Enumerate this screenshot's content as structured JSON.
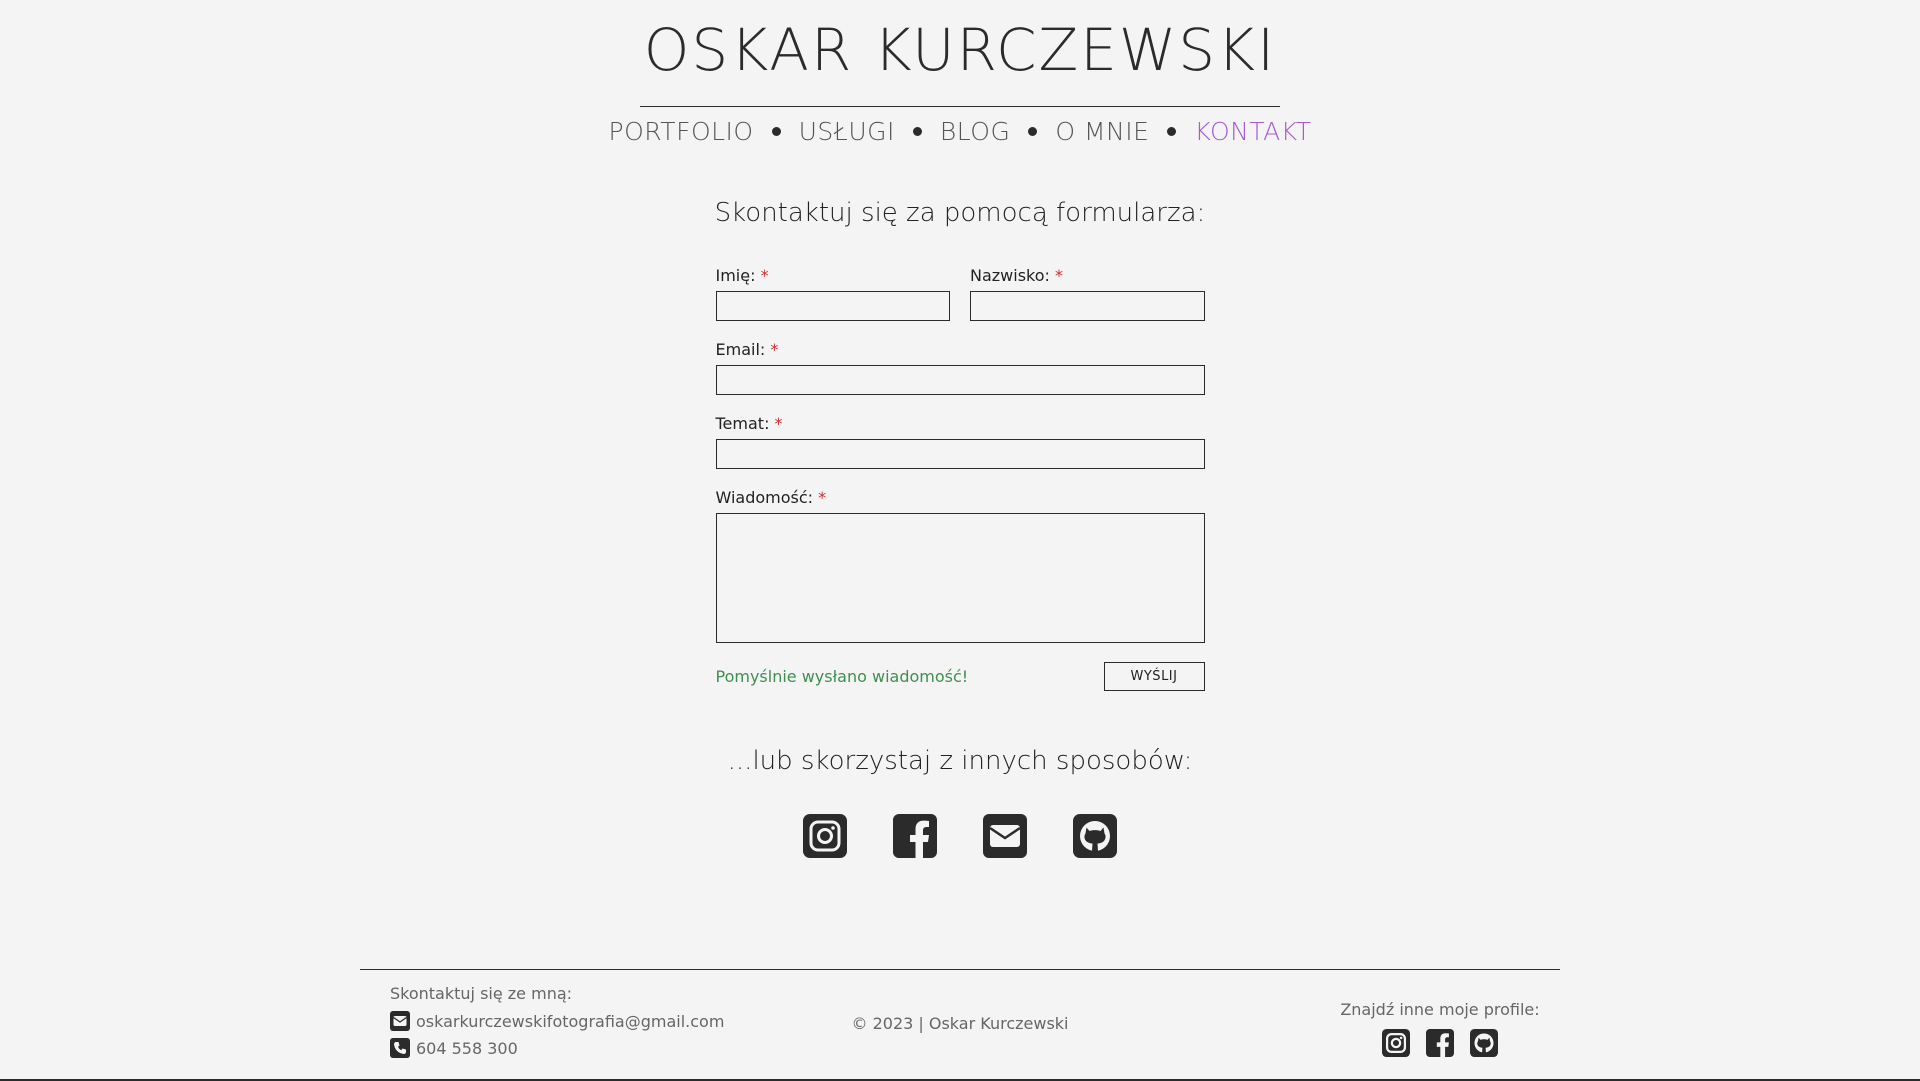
{
  "header": {
    "title": "OSKAR KURCZEWSKI"
  },
  "nav": {
    "items": [
      {
        "label": "PORTFOLIO"
      },
      {
        "label": "USŁUGI"
      },
      {
        "label": "BLOG"
      },
      {
        "label": "O MNIE"
      },
      {
        "label": "KONTAKT",
        "active": true
      }
    ],
    "active_color": "#a75ad4"
  },
  "form": {
    "heading": "Skontaktuj się za pomocą formularza:",
    "first_name_label": "Imię:",
    "last_name_label": "Nazwisko:",
    "email_label": "Email:",
    "subject_label": "Temat:",
    "message_label": "Wiadomość:",
    "required_mark": "*",
    "first_name_value": "",
    "last_name_value": "",
    "email_value": "",
    "subject_value": "",
    "message_value": "",
    "success_message": "Pomyślnie wysłano wiadomość!",
    "submit_label": "WYŚLIJ",
    "success_color": "#3f8f4f",
    "required_color": "#d02b2b"
  },
  "alternatives": {
    "heading": "...lub skorzystaj z innych sposobów:",
    "icons": [
      "instagram-icon",
      "facebook-icon",
      "mail-icon",
      "github-icon"
    ]
  },
  "footer": {
    "contact_title": "Skontaktuj się ze mną:",
    "email": "oskarkurczewskifotografia@gmail.com",
    "phone": "604 558 300",
    "copyright": "© 2023 | Oskar Kurczewski",
    "profiles_title": "Znajdź inne moje profile:",
    "profile_icons": [
      "instagram-icon",
      "facebook-icon",
      "github-icon"
    ]
  }
}
